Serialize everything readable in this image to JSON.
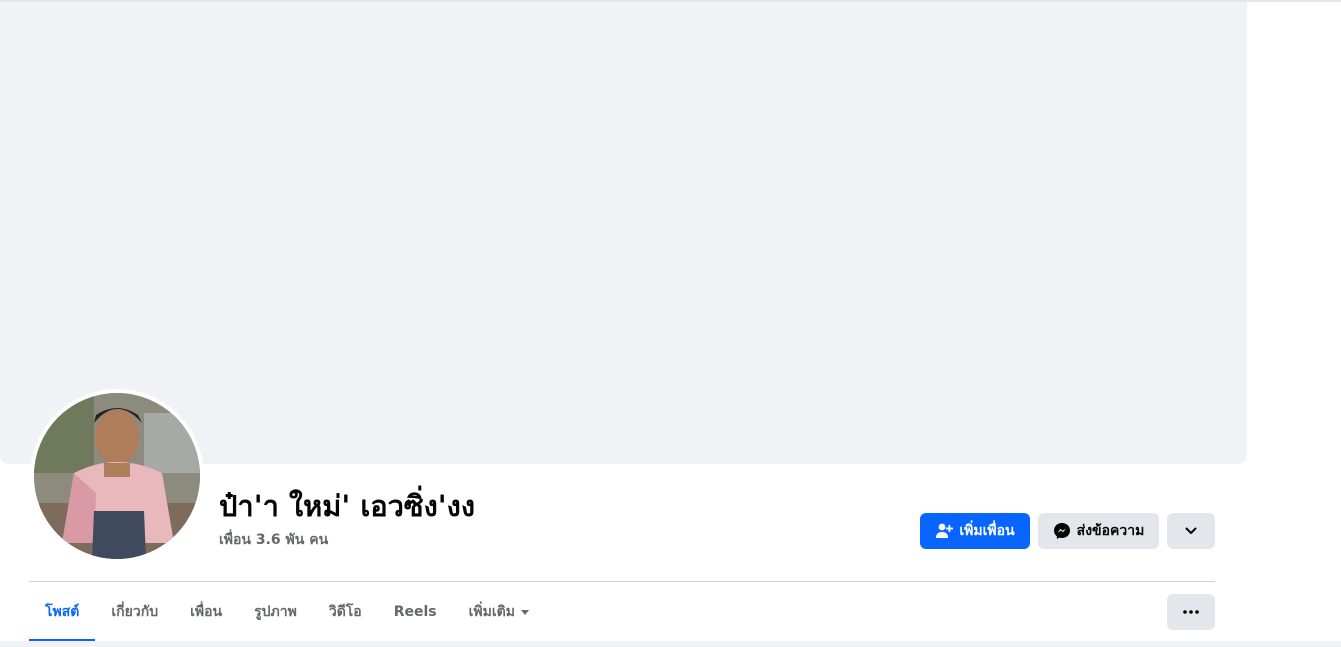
{
  "profile": {
    "name": "ป๋า'า ใหม่' เอวซิ่ง'งง",
    "friends_count": "เพื่อน 3.6 พัน คน"
  },
  "actions": {
    "add_friend": "เพิ่มเพื่อน",
    "message": "ส่งข้อความ"
  },
  "tabs": [
    {
      "label": "โพสต์",
      "active": true
    },
    {
      "label": "เกี่ยวกับ"
    },
    {
      "label": "เพื่อน"
    },
    {
      "label": "รูปภาพ"
    },
    {
      "label": "วิดีโอ"
    },
    {
      "label": "Reels"
    },
    {
      "label": "เพิ่มเติม"
    }
  ],
  "icons": {
    "add_friend": "person-plus-icon",
    "message": "messenger-icon",
    "more_profile": "chevron-down-icon",
    "more_tabs": "ellipsis-icon",
    "tab_more": "caret-down-icon"
  },
  "colors": {
    "primary": "#0866ff",
    "secondary_button": "#e4e6eb",
    "cover": "#f0f2f5",
    "muted_text": "#65676b"
  }
}
